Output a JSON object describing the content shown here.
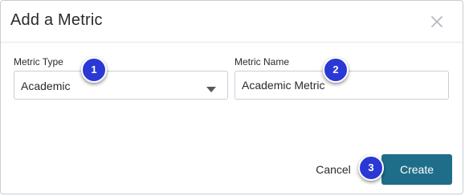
{
  "dialog": {
    "title": "Add a Metric",
    "close_icon": "close-icon"
  },
  "form": {
    "metric_type": {
      "label": "Metric Type",
      "selected_value": "Academic",
      "caret_icon": "caret-down-icon"
    },
    "metric_name": {
      "label": "Metric Name",
      "value": "Academic Metric"
    }
  },
  "footer": {
    "cancel_label": "Cancel",
    "create_label": "Create"
  },
  "step_markers": [
    "1",
    "2",
    "3"
  ],
  "colors": {
    "primary_button": "#1f6e89",
    "marker": "#2a38d6",
    "border": "#c9ced4"
  }
}
